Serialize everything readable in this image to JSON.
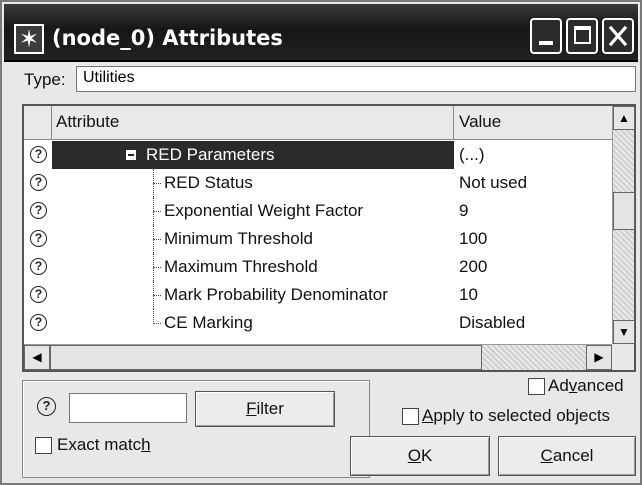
{
  "window": {
    "title": "(node_0) Attributes"
  },
  "type_row": {
    "label": "Type:",
    "value": "Utilities"
  },
  "grid": {
    "columns": [
      "Attribute",
      "Value"
    ],
    "rows": [
      {
        "attribute": "RED Parameters",
        "value": "(...)",
        "selected": true,
        "is_group": true
      },
      {
        "attribute": "RED Status",
        "value": "Not used"
      },
      {
        "attribute": "Exponential Weight Factor",
        "value": "9"
      },
      {
        "attribute": "Minimum Threshold",
        "value": "100"
      },
      {
        "attribute": "Maximum Threshold",
        "value": "200"
      },
      {
        "attribute": "Mark Probability Denominator",
        "value": "10"
      },
      {
        "attribute": "CE Marking",
        "value": "Disabled"
      }
    ]
  },
  "filter": {
    "input_value": "",
    "filter_button": {
      "pre": "",
      "ul": "F",
      "post": "ilter"
    },
    "exact_match": {
      "pre": "Exact matc",
      "ul": "h",
      "post": ""
    }
  },
  "options": {
    "advanced": {
      "pre": "Ad",
      "ul": "v",
      "post": "anced"
    },
    "apply_selected": {
      "pre": "",
      "ul": "A",
      "post": "pply to selected objects"
    }
  },
  "buttons": {
    "ok": {
      "pre": "",
      "ul": "O",
      "post": "K"
    },
    "cancel": {
      "pre": "",
      "ul": "C",
      "post": "ancel"
    }
  },
  "icons": {
    "help": "?",
    "title": "✶",
    "scroll_up": "▲",
    "scroll_down": "▼",
    "scroll_left": "◀",
    "scroll_right": "▶"
  }
}
